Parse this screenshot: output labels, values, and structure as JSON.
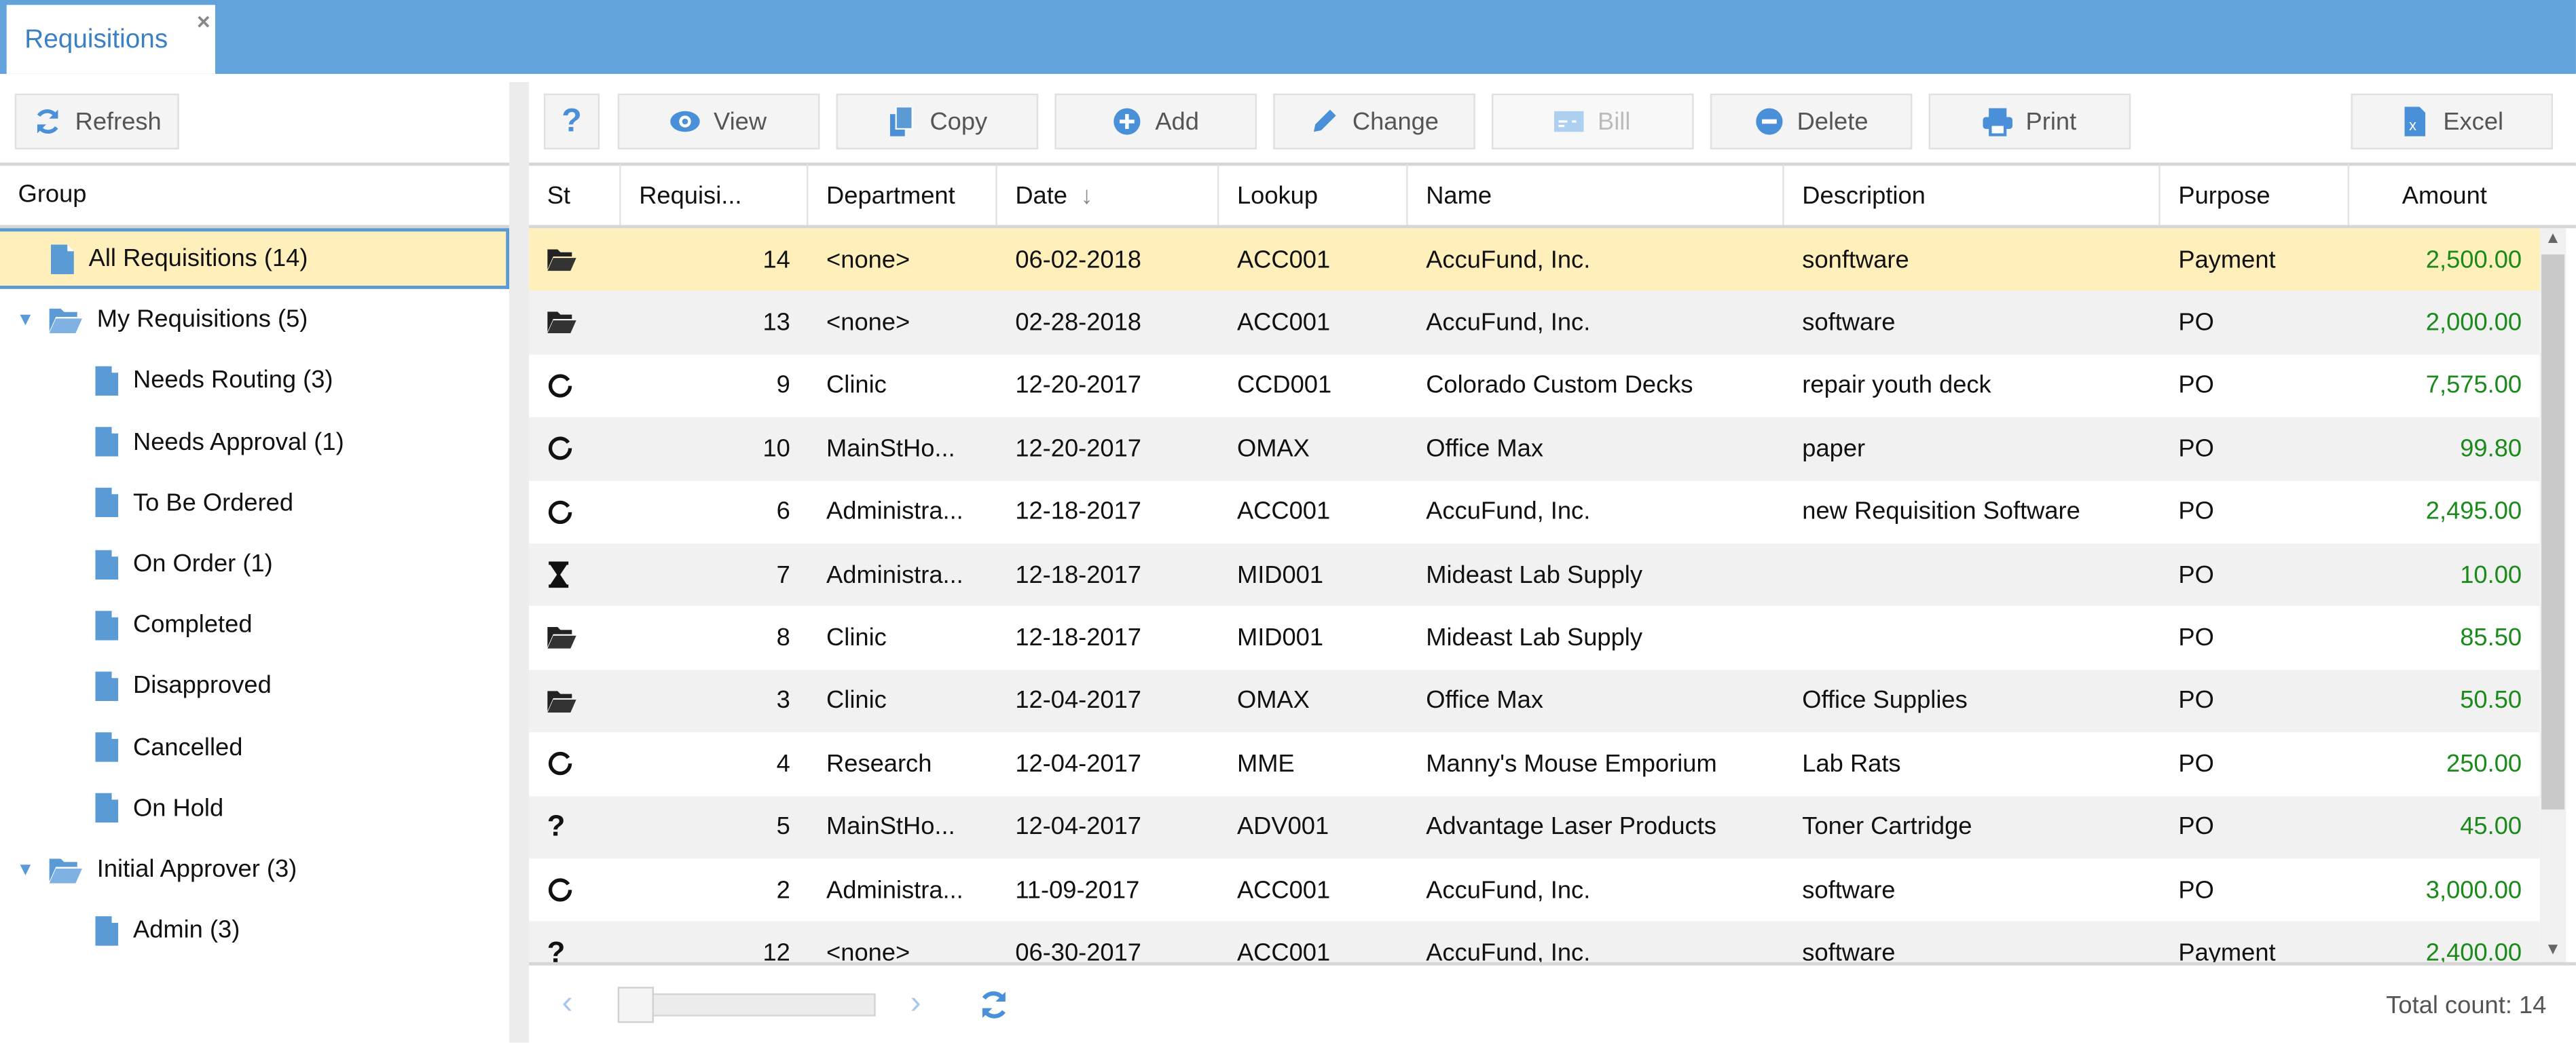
{
  "tab": {
    "title": "Requisitions",
    "close": "×"
  },
  "left": {
    "refresh_label": "Refresh",
    "group_header": "Group",
    "tree": [
      {
        "label": "All Requisitions (14)",
        "level": 0,
        "icon": "document-icon",
        "selected": true
      },
      {
        "label": "My Requisitions (5)",
        "level": 0,
        "icon": "folder-open-icon",
        "expanded": true
      },
      {
        "label": "Needs Routing (3)",
        "level": 1,
        "icon": "document-icon"
      },
      {
        "label": "Needs Approval (1)",
        "level": 1,
        "icon": "document-icon"
      },
      {
        "label": "To Be Ordered",
        "level": 1,
        "icon": "document-icon"
      },
      {
        "label": "On Order (1)",
        "level": 1,
        "icon": "document-icon"
      },
      {
        "label": "Completed",
        "level": 1,
        "icon": "document-icon"
      },
      {
        "label": "Disapproved",
        "level": 1,
        "icon": "document-icon"
      },
      {
        "label": "Cancelled",
        "level": 1,
        "icon": "document-icon"
      },
      {
        "label": "On Hold",
        "level": 1,
        "icon": "document-icon"
      },
      {
        "label": "Initial Approver (3)",
        "level": 0,
        "icon": "folder-open-icon",
        "expanded": true
      },
      {
        "label": "Admin (3)",
        "level": 1,
        "icon": "document-icon"
      }
    ]
  },
  "toolbar": {
    "help": "?",
    "buttons": [
      {
        "label": "View",
        "icon": "eye-icon"
      },
      {
        "label": "Copy",
        "icon": "copy-icon"
      },
      {
        "label": "Add",
        "icon": "plus-circle-icon"
      },
      {
        "label": "Change",
        "icon": "pencil-icon"
      },
      {
        "label": "Bill",
        "icon": "bill-icon",
        "disabled": true
      },
      {
        "label": "Delete",
        "icon": "minus-circle-icon"
      },
      {
        "label": "Print",
        "icon": "printer-icon"
      },
      {
        "label": "Excel",
        "icon": "excel-icon"
      }
    ]
  },
  "grid": {
    "columns": [
      "St",
      "Requisi...",
      "Department",
      "Date",
      "Lookup",
      "Name",
      "Description",
      "Purpose",
      "Amount"
    ],
    "sort_indicator": "↓",
    "rows": [
      {
        "st": "folder-open",
        "req": "14",
        "dept": "<none>",
        "date": "06-02-2018",
        "lookup": "ACC001",
        "name": "AccuFund, Inc.",
        "desc": "sonftware",
        "purpose": "Payment",
        "amount": "2,500.00"
      },
      {
        "st": "folder-open",
        "req": "13",
        "dept": "<none>",
        "date": "02-28-2018",
        "lookup": "ACC001",
        "name": "AccuFund, Inc.",
        "desc": "software",
        "purpose": "PO",
        "amount": "2,000.00"
      },
      {
        "st": "circle",
        "req": "9",
        "dept": "Clinic",
        "date": "12-20-2017",
        "lookup": "CCD001",
        "name": "Colorado Custom Decks",
        "desc": "repair youth deck",
        "purpose": "PO",
        "amount": "7,575.00"
      },
      {
        "st": "circle",
        "req": "10",
        "dept": "MainStHo...",
        "date": "12-20-2017",
        "lookup": "OMAX",
        "name": "Office Max",
        "desc": "paper",
        "purpose": "PO",
        "amount": "99.80"
      },
      {
        "st": "circle",
        "req": "6",
        "dept": "Administra...",
        "date": "12-18-2017",
        "lookup": "ACC001",
        "name": "AccuFund, Inc.",
        "desc": "new Requisition Software",
        "purpose": "PO",
        "amount": "2,495.00"
      },
      {
        "st": "hourglass",
        "req": "7",
        "dept": "Administra...",
        "date": "12-18-2017",
        "lookup": "MID001",
        "name": "Mideast Lab Supply",
        "desc": "",
        "purpose": "PO",
        "amount": "10.00"
      },
      {
        "st": "folder-open",
        "req": "8",
        "dept": "Clinic",
        "date": "12-18-2017",
        "lookup": "MID001",
        "name": "Mideast Lab Supply",
        "desc": "",
        "purpose": "PO",
        "amount": "85.50"
      },
      {
        "st": "folder-open",
        "req": "3",
        "dept": "Clinic",
        "date": "12-04-2017",
        "lookup": "OMAX",
        "name": "Office Max",
        "desc": "Office Supplies",
        "purpose": "PO",
        "amount": "50.50"
      },
      {
        "st": "circle",
        "req": "4",
        "dept": "Research",
        "date": "12-04-2017",
        "lookup": "MME",
        "name": "Manny's Mouse Emporium",
        "desc": "Lab Rats",
        "purpose": "PO",
        "amount": "250.00"
      },
      {
        "st": "question",
        "req": "5",
        "dept": "MainStHo...",
        "date": "12-04-2017",
        "lookup": "ADV001",
        "name": "Advantage Laser Products",
        "desc": "Toner Cartridge",
        "purpose": "PO",
        "amount": "45.00"
      },
      {
        "st": "circle",
        "req": "2",
        "dept": "Administra...",
        "date": "11-09-2017",
        "lookup": "ACC001",
        "name": "AccuFund, Inc.",
        "desc": "software",
        "purpose": "PO",
        "amount": "3,000.00"
      },
      {
        "st": "question",
        "req": "12",
        "dept": "<none>",
        "date": "06-30-2017",
        "lookup": "ACC001",
        "name": "AccuFund, Inc.",
        "desc": "software",
        "purpose": "Payment",
        "amount": "2,400.00"
      }
    ]
  },
  "footer": {
    "total": "Total count: 14"
  },
  "colors": {
    "accent": "#62a3dc",
    "selected": "#feefbb",
    "amount": "#1a8a1a"
  }
}
